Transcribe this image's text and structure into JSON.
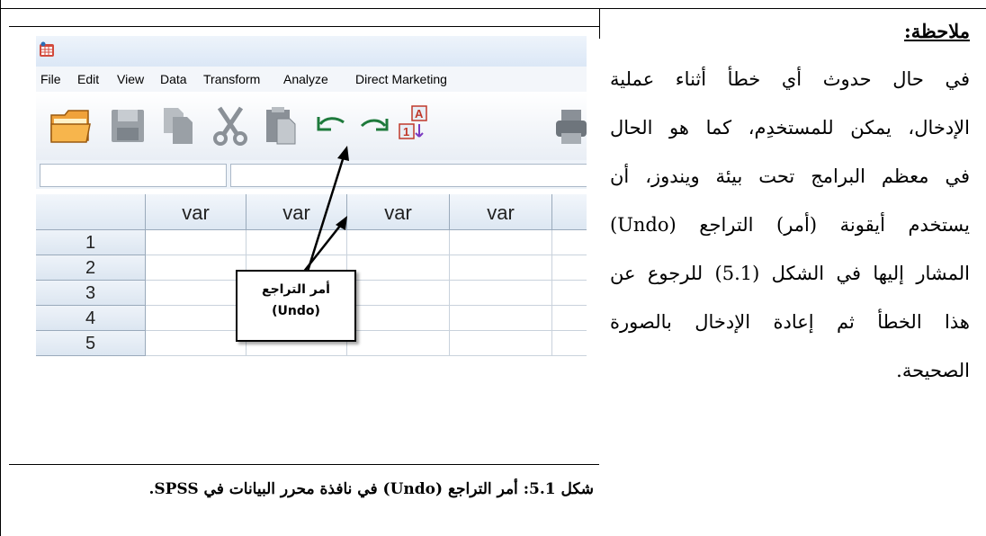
{
  "note": {
    "title": "ملاحظة:",
    "lines": [
      "في حال حدوث أي خطأ أثناء عملية",
      "الإدخال، يمكن للمستخدِم، كما هو الحال",
      "في معظم البرامج تحت بيئة ويندوز، أن",
      "يستخدم أيقونة (أمر) التراجع (Undo)",
      "المشار إليها في الشكل (5.1) للرجوع عن",
      "هذا الخطأ ثم إعادة الإدخال بالصورة",
      "الصحيحة."
    ]
  },
  "spss": {
    "menu": [
      "File",
      "Edit",
      "View",
      "Data",
      "Transform",
      "Analyze",
      "Direct Marketing"
    ],
    "toolbar_icons": [
      "open-folder-icon",
      "save-icon",
      "copy-icon",
      "cut-icon",
      "paste-icon",
      "undo-icon",
      "redo-icon",
      "variable-label-icon",
      "print-icon"
    ],
    "columns": [
      "var",
      "var",
      "var",
      "var"
    ],
    "rows": [
      "1",
      "2",
      "3",
      "4",
      "5"
    ]
  },
  "callout": {
    "line1": "أمر التراجع",
    "line2": "(Undo)"
  },
  "caption": "شكل 5.1: أمر التراجع (Undo) في نافذة محرر البيانات في SPSS."
}
